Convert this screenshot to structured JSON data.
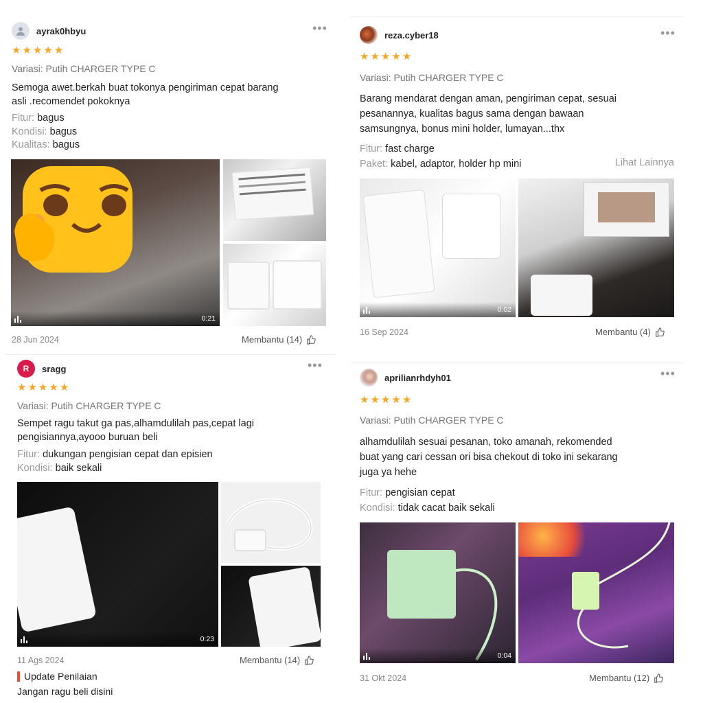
{
  "reviews": [
    {
      "username": "ayrak0hbyu",
      "avatar": "default-user-icon",
      "stars": 5,
      "variant": "Variasi: Putih CHARGER TYPE C",
      "body_lines": [
        "Semoga awet.berkah buat tokonya pengiriman cepat barang",
        "asli .recomendet pokoknya"
      ],
      "attrs": [
        {
          "key": "Fitur:",
          "value": "bagus"
        },
        {
          "key": "Kondisi:",
          "value": "bagus"
        },
        {
          "key": "Kualitas:",
          "value": "bagus"
        }
      ],
      "video_duration": "0:21",
      "date": "28 Jun 2024",
      "helpful": "Membantu (14)"
    },
    {
      "username": "reza.cyber18",
      "avatar": "user-photo",
      "stars": 5,
      "variant": "Variasi: Putih CHARGER TYPE C",
      "body_lines": [
        "Barang mendarat dengan aman, pengiriman cepat, sesuai",
        "pesanannya, kualitas bagus sama dengan bawaan",
        "samsungnya, bonus mini holder, lumayan...thx"
      ],
      "attrs": [
        {
          "key": "Fitur:",
          "value": "fast charge"
        },
        {
          "key": "Paket:",
          "value": "kabel, adaptor, holder hp mini"
        }
      ],
      "see_more": "Lihat Lainnya",
      "video_duration": "0:02",
      "date": "16 Sep 2024",
      "helpful": "Membantu (4)"
    },
    {
      "username": "sragg",
      "avatar_letter": "R",
      "stars": 5,
      "variant": "Variasi: Putih CHARGER TYPE C",
      "body_lines": [
        "Sempet ragu takut ga pas,alhamdulilah pas,cepat lagi",
        "pengisiannya,ayooo buruan beli"
      ],
      "attrs": [
        {
          "key": "Fitur:",
          "value": "dukungan pengisian cepat dan episien"
        },
        {
          "key": "Kondisi:",
          "value": "baik sekali"
        }
      ],
      "video_duration": "0:23",
      "date": "11 Ags 2024",
      "helpful": "Membantu (14)",
      "update_label": "Update Penilaian",
      "update_text": "Jangan ragu beli disini"
    },
    {
      "username": "aprilianrhdyh01",
      "avatar": "user-photo",
      "stars": 5,
      "variant": "Variasi: Putih CHARGER TYPE C",
      "body_lines": [
        "alhamdulilah sesuai pesanan, toko amanah, rekomended",
        "buat yang cari cessan ori bisa chekout di toko ini sekarang",
        "juga ya hehe"
      ],
      "attrs": [
        {
          "key": "Fitur:",
          "value": "pengisian cepat"
        },
        {
          "key": "Kondisi:",
          "value": "tidak cacat baik sekali"
        }
      ],
      "video_duration": "0:04",
      "date": "31 Okt 2024",
      "helpful": "Membantu (12)"
    }
  ],
  "colors": {
    "star": "#f5a623",
    "attr_key": "#9a9a9a",
    "update_bar": "#ee4d2d",
    "avatar_letter_bg": "#d81b4a"
  }
}
